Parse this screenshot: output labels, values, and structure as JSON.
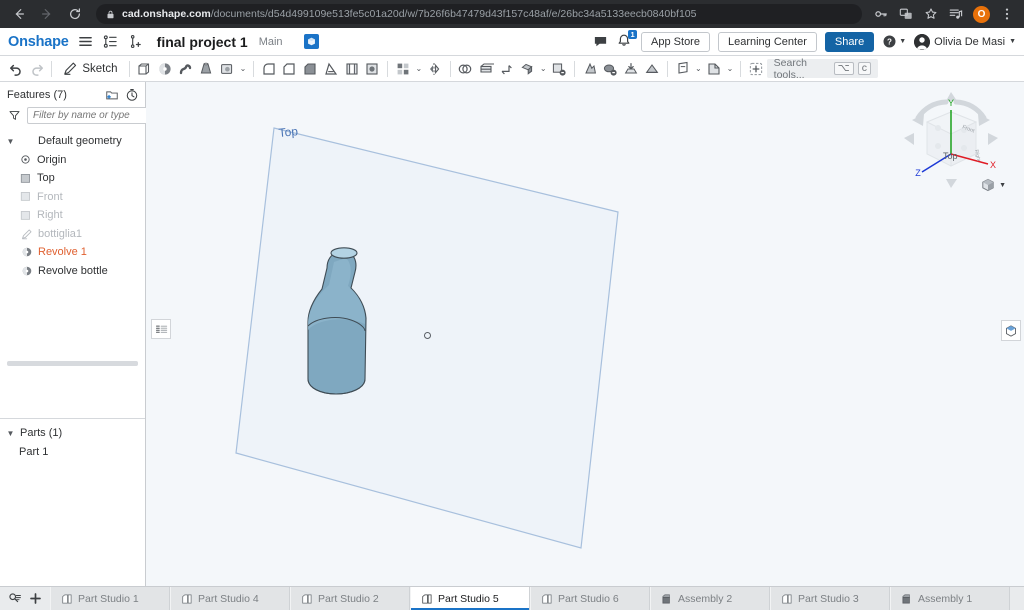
{
  "browser": {
    "back_icon": "arrow-left-icon",
    "forward_icon": "arrow-right-icon",
    "reload_icon": "reload-icon",
    "url_host": "cad.onshape.com",
    "url_path": "/documents/d54d499109e513fe5c01a20d/w/7b26f6b47479d43f157c48af/e/26bc34a5133eecb0840bf105",
    "icons": [
      "key-icon",
      "translate-icon",
      "bookmark-star-icon",
      "reading-list-icon",
      "chrome-menu-icon"
    ],
    "profile_initial": "O"
  },
  "header": {
    "logo": "Onshape",
    "menu_icon": "hamburger-menu-icon",
    "versions_icon": "version-graph-icon",
    "branch_icon": "add-branch-icon",
    "document_title": "final project 1",
    "workspace": "Main",
    "document_chip_icon": "document-type-icon",
    "comments_icon": "comment-bubble-icon",
    "notifications_icon": "notification-bell-icon",
    "notifications_count": "1",
    "app_store_label": "App Store",
    "learning_center_label": "Learning Center",
    "share_label": "Share",
    "help_icon": "help-circle-icon",
    "user_name": "Olivia De Masi",
    "accent_blue": "#1464a5"
  },
  "toolbar": {
    "undo_icon": "undo-icon",
    "redo_icon": "redo-icon",
    "sketch_label": "Sketch",
    "sketch_icon": "sketch-pencil-icon",
    "tools": [
      "extrude-icon",
      "revolve-icon",
      "sweep-icon",
      "loft-icon",
      "thicken-icon",
      "fillet-icon",
      "chamfer-icon",
      "draft-icon",
      "rib-icon",
      "shell-icon",
      "hole-icon",
      "pattern-icon",
      "mirror-icon",
      "boolean-icon",
      "split-icon",
      "transform-icon",
      "move-face-icon",
      "delete-face-icon",
      "replace-face-icon",
      "offset-surface-icon",
      "plane-icon",
      "sketch-plane-icon",
      "curve-icon",
      "derived-icon",
      "insert-icon"
    ],
    "search_placeholder": "Search tools...",
    "search_kbd_1": "⌥",
    "search_kbd_2": "c"
  },
  "features_panel": {
    "title": "Features (7)",
    "new_folder_icon": "new-folder-icon",
    "history_icon": "history-clock-icon",
    "filter_icon": "filter-funnel-icon",
    "filter_placeholder": "Filter by name or type",
    "tree": [
      {
        "label": "Default geometry",
        "icon": "folder-icon",
        "state": "normal",
        "indent": 0,
        "twisty": "down"
      },
      {
        "label": "Origin",
        "icon": "origin-icon",
        "state": "normal",
        "indent": 1,
        "twisty": ""
      },
      {
        "label": "Top",
        "icon": "plane-icon",
        "state": "normal",
        "indent": 1,
        "twisty": ""
      },
      {
        "label": "Front",
        "icon": "plane-icon",
        "state": "dim",
        "indent": 1,
        "twisty": ""
      },
      {
        "label": "Right",
        "icon": "plane-icon",
        "state": "dim",
        "indent": 1,
        "twisty": ""
      },
      {
        "label": "bottiglia1",
        "icon": "sketch-icon",
        "state": "dim",
        "indent": 0,
        "twisty": ""
      },
      {
        "label": "Revolve 1",
        "icon": "revolve-icon",
        "state": "error",
        "indent": 0,
        "twisty": ""
      },
      {
        "label": "Revolve bottle",
        "icon": "revolve-icon",
        "state": "normal",
        "indent": 0,
        "twisty": ""
      }
    ],
    "parts_title": "Parts (1)",
    "parts": [
      {
        "label": "Part 1"
      }
    ]
  },
  "viewport": {
    "plane_label": "Top",
    "sketch_plane_fill": "#eef3f9",
    "sketch_plane_stroke": "#a8c0dd",
    "part_color": "#7fa8c0",
    "background": "#f4f7fa",
    "panel_toggle_icon": "feature-list-toggle-icon",
    "render_studio_icon": "render-cube-icon",
    "view_cube": {
      "face_label": "Top",
      "axis_x": "X",
      "axis_y": "Y",
      "axis_z": "Z",
      "axis_x_color": "#e01b24",
      "axis_y_color": "#1aa11a",
      "axis_z_color": "#1c39d6",
      "display_mode_icon": "shaded-cube-icon"
    }
  },
  "tabbar": {
    "search_tabs_icon": "search-tabs-icon",
    "add_tab_icon": "add-tab-icon",
    "tabs": [
      {
        "label": "Part Studio 1",
        "icon": "part-studio-icon",
        "active": false
      },
      {
        "label": "Part Studio 4",
        "icon": "part-studio-icon",
        "active": false
      },
      {
        "label": "Part Studio 2",
        "icon": "part-studio-icon",
        "active": false
      },
      {
        "label": "Part Studio 5",
        "icon": "part-studio-icon",
        "active": true
      },
      {
        "label": "Part Studio 6",
        "icon": "part-studio-icon",
        "active": false
      },
      {
        "label": "Assembly 2",
        "icon": "assembly-icon",
        "active": false
      },
      {
        "label": "Part Studio 3",
        "icon": "part-studio-icon",
        "active": false
      },
      {
        "label": "Assembly 1",
        "icon": "assembly-icon",
        "active": false
      }
    ]
  }
}
